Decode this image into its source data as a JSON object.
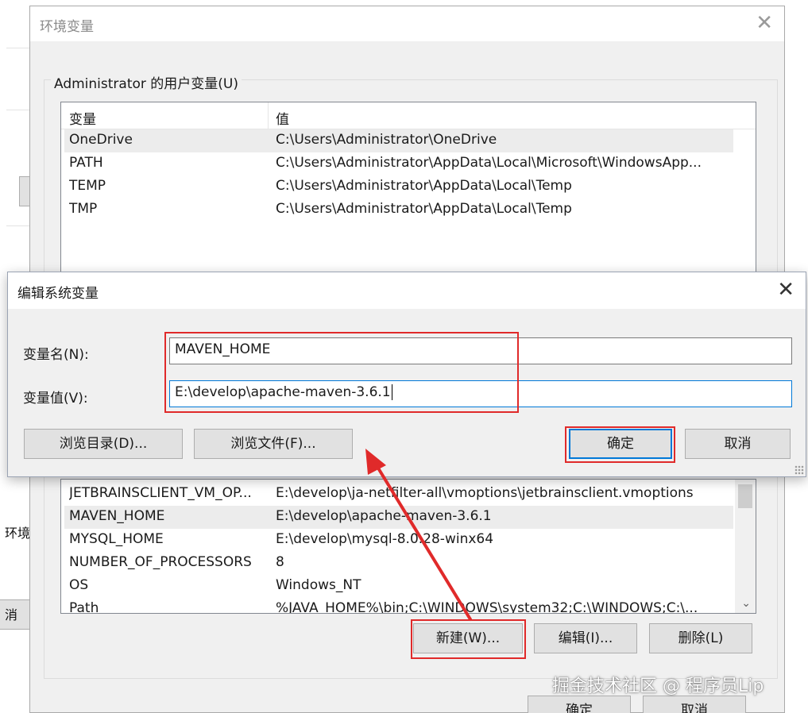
{
  "background": {
    "fragment_text_1": "环境",
    "fragment_text_2": "消"
  },
  "env_window": {
    "title": "环境变量",
    "close_glyph": "✕",
    "user_group_label": "Administrator 的用户变量(U)",
    "columns": {
      "name": "变量",
      "value": "值"
    },
    "user_vars": [
      {
        "name": "OneDrive",
        "value": "C:\\Users\\Administrator\\OneDrive",
        "selected": true
      },
      {
        "name": "PATH",
        "value": "C:\\Users\\Administrator\\AppData\\Local\\Microsoft\\WindowsApp...",
        "selected": false
      },
      {
        "name": "TEMP",
        "value": "C:\\Users\\Administrator\\AppData\\Local\\Temp",
        "selected": false
      },
      {
        "name": "TMP",
        "value": "C:\\Users\\Administrator\\AppData\\Local\\Temp",
        "selected": false
      }
    ],
    "system_vars": [
      {
        "name": "JETBRAINSCLIENT_VM_OP...",
        "value": "E:\\develop\\ja-netfilter-all\\vmoptions\\jetbrainsclient.vmoptions",
        "selected": false
      },
      {
        "name": "MAVEN_HOME",
        "value": "E:\\develop\\apache-maven-3.6.1",
        "selected": true
      },
      {
        "name": "MYSQL_HOME",
        "value": "E:\\develop\\mysql-8.0.28-winx64",
        "selected": false
      },
      {
        "name": "NUMBER_OF_PROCESSORS",
        "value": "8",
        "selected": false
      },
      {
        "name": "OS",
        "value": "Windows_NT",
        "selected": false
      },
      {
        "name": "Path",
        "value": "%JAVA_HOME%\\bin;C:\\WINDOWS\\system32;C:\\WINDOWS;C:\\...",
        "selected": false
      }
    ],
    "system_buttons": {
      "new": "新建(W)...",
      "edit": "编辑(I)...",
      "delete": "删除(L)"
    },
    "footer_buttons": {
      "ok": "确定",
      "cancel": "取消"
    }
  },
  "edit_dialog": {
    "title": "编辑系统变量",
    "close_glyph": "✕",
    "name_label": "变量名(N):",
    "name_value": "MAVEN_HOME",
    "value_label": "变量值(V):",
    "value_value": "E:\\develop\\apache-maven-3.6.1",
    "browse_dir": "浏览目录(D)...",
    "browse_file": "浏览文件(F)...",
    "ok": "确定",
    "cancel": "取消"
  },
  "annotation_color": "#e02a2a",
  "watermark": "掘金技术社区 @ 程序员Lip"
}
